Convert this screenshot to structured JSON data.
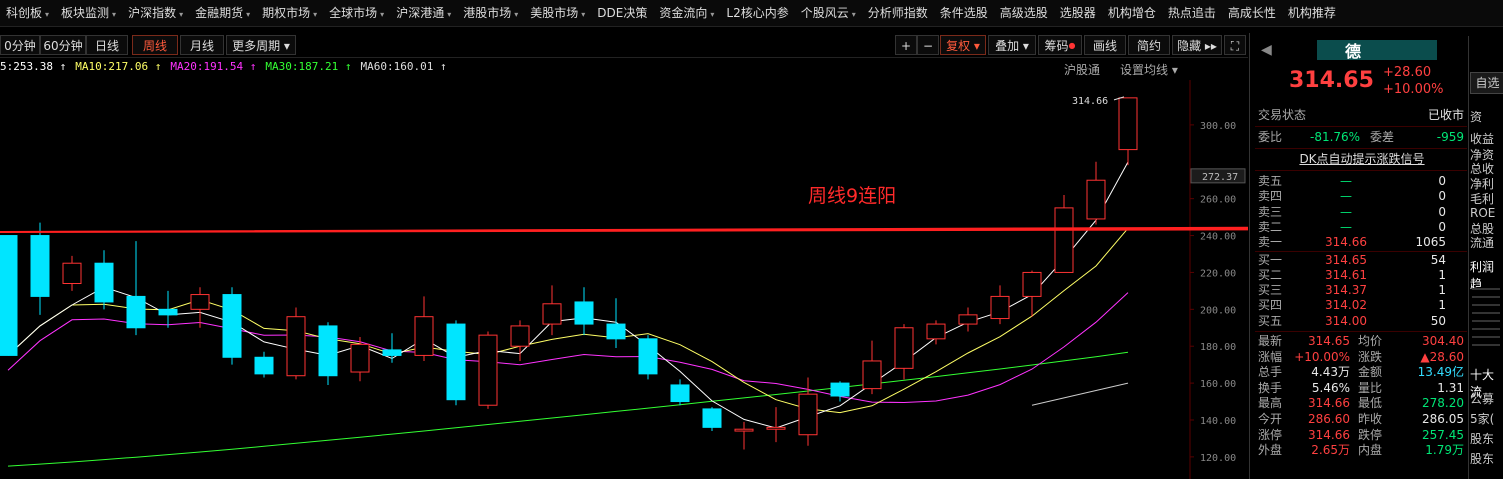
{
  "menu": [
    {
      "label": "科创板",
      "caret": true
    },
    {
      "label": "板块监测",
      "caret": true
    },
    {
      "label": "沪深指数",
      "caret": true
    },
    {
      "label": "金融期货",
      "caret": true
    },
    {
      "label": "期权市场",
      "caret": true
    },
    {
      "label": "全球市场",
      "caret": true
    },
    {
      "label": "沪深港通",
      "caret": true
    },
    {
      "label": "港股市场",
      "caret": true
    },
    {
      "label": "美股市场",
      "caret": true
    },
    {
      "label": "DDE决策",
      "caret": false
    },
    {
      "label": "资金流向",
      "caret": true
    },
    {
      "label": "L2核心内参",
      "caret": false
    },
    {
      "label": "个股风云",
      "caret": true
    },
    {
      "label": "分析师指数",
      "caret": false
    },
    {
      "label": "条件选股",
      "caret": false
    },
    {
      "label": "高级选股",
      "caret": false
    },
    {
      "label": "选股器",
      "caret": false
    },
    {
      "label": "机构增仓",
      "caret": false
    },
    {
      "label": "热点追击",
      "caret": false
    },
    {
      "label": "高成长性",
      "caret": false
    },
    {
      "label": "机构推荐",
      "caret": false
    }
  ],
  "toolbar": {
    "periods": [
      "0分钟",
      "60分钟",
      "日线",
      "周线",
      "月线",
      "更多周期 ▾"
    ],
    "active_period": "周线",
    "right": {
      "plus": "+",
      "minus": "−",
      "fuquan": "复权 ▾",
      "diejia": "叠加 ▾",
      "chouma": "筹码",
      "huaxian": "画线",
      "jianyue": "简约",
      "yincang": "隐藏 ▸▸"
    }
  },
  "ma_row": {
    "ma5": "5:253.38 ↑",
    "ma10": "MA10:217.06 ↑",
    "ma20": "MA20:191.54 ↑",
    "ma30": "MA30:187.21 ↑",
    "ma60": "MA60:160.01 ↑",
    "market": "沪股通",
    "settings": "设置均线 ▾"
  },
  "chart_data": {
    "type": "candlestick",
    "annotation": "周线9连阳",
    "high_label": "314.66",
    "current_price_label": "272.37",
    "yticks": [
      120,
      140,
      160,
      180,
      200,
      220,
      240,
      260,
      300
    ],
    "ytick_labels": [
      "120.00",
      "140.00",
      "160.00",
      "180.00",
      "200.00",
      "220.00",
      "240.00",
      "260.00",
      "300.00"
    ],
    "ylim": [
      108,
      320
    ],
    "candles": [
      {
        "o": 240,
        "c": 175,
        "h": 240,
        "l": 175
      },
      {
        "o": 240,
        "c": 207,
        "h": 247,
        "l": 197
      },
      {
        "o": 214,
        "c": 225,
        "h": 229,
        "l": 210
      },
      {
        "o": 225,
        "c": 204,
        "h": 232,
        "l": 200
      },
      {
        "o": 207,
        "c": 190,
        "h": 237,
        "l": 186
      },
      {
        "o": 200,
        "c": 197,
        "h": 210,
        "l": 190
      },
      {
        "o": 200,
        "c": 208,
        "h": 212,
        "l": 190
      },
      {
        "o": 208,
        "c": 174,
        "h": 212,
        "l": 170
      },
      {
        "o": 174,
        "c": 165,
        "h": 177,
        "l": 163
      },
      {
        "o": 164,
        "c": 196,
        "h": 201,
        "l": 162
      },
      {
        "o": 191,
        "c": 164,
        "h": 193,
        "l": 159
      },
      {
        "o": 166,
        "c": 181,
        "h": 185,
        "l": 161
      },
      {
        "o": 178,
        "c": 175,
        "h": 187,
        "l": 171
      },
      {
        "o": 175,
        "c": 196,
        "h": 207,
        "l": 172
      },
      {
        "o": 192,
        "c": 151,
        "h": 194,
        "l": 148
      },
      {
        "o": 148,
        "c": 186,
        "h": 188,
        "l": 146
      },
      {
        "o": 180,
        "c": 191,
        "h": 194,
        "l": 172
      },
      {
        "o": 192,
        "c": 203,
        "h": 213,
        "l": 186
      },
      {
        "o": 204,
        "c": 192,
        "h": 212,
        "l": 186
      },
      {
        "o": 192,
        "c": 184,
        "h": 206,
        "l": 179
      },
      {
        "o": 184,
        "c": 165,
        "h": 186,
        "l": 162
      },
      {
        "o": 159,
        "c": 150,
        "h": 162,
        "l": 148
      },
      {
        "o": 146,
        "c": 136,
        "h": 147,
        "l": 134
      },
      {
        "o": 134,
        "c": 135,
        "h": 139,
        "l": 124
      },
      {
        "o": 135,
        "c": 136,
        "h": 147,
        "l": 128
      },
      {
        "o": 132,
        "c": 154,
        "h": 163,
        "l": 126
      },
      {
        "o": 160,
        "c": 153,
        "h": 161,
        "l": 150
      },
      {
        "o": 157,
        "c": 172,
        "h": 183,
        "l": 154
      },
      {
        "o": 168,
        "c": 190,
        "h": 192,
        "l": 162
      },
      {
        "o": 184,
        "c": 192,
        "h": 194,
        "l": 181
      },
      {
        "o": 192,
        "c": 197,
        "h": 201,
        "l": 188
      },
      {
        "o": 195,
        "c": 207,
        "h": 213,
        "l": 192
      },
      {
        "o": 207,
        "c": 220,
        "h": 221,
        "l": 196
      },
      {
        "o": 220,
        "c": 255,
        "h": 262,
        "l": 220
      },
      {
        "o": 249,
        "c": 270,
        "h": 280,
        "l": 246
      },
      {
        "o": 286.6,
        "c": 314.66,
        "h": 314.66,
        "l": 278.2
      }
    ],
    "ma_colors": {
      "ma5": "#ffffff",
      "ma10": "#ffff66",
      "ma20": "#ff33ff",
      "ma30": "#33ff33",
      "ma60": "#bbbbbb"
    },
    "up_color": "#ff3333",
    "down_color": "#00e5ff"
  },
  "quote": {
    "name": "德",
    "price": "314.65",
    "change": "+28.60",
    "pct": "+10.00%",
    "trade_state_label": "交易状态",
    "trade_state": "已收市",
    "weibi_label": "委比",
    "weibi": "-81.76%",
    "weicha_label": "委差",
    "weicha": "-959",
    "dk_label": "DK点自动提示涨跌信号",
    "sells": [
      {
        "label": "卖五",
        "price": "—",
        "vol": "0"
      },
      {
        "label": "卖四",
        "price": "—",
        "vol": "0"
      },
      {
        "label": "卖三",
        "price": "—",
        "vol": "0"
      },
      {
        "label": "卖二",
        "price": "—",
        "vol": "0"
      },
      {
        "label": "卖一",
        "price": "314.66",
        "vol": "1065"
      }
    ],
    "buys": [
      {
        "label": "买一",
        "price": "314.65",
        "vol": "54"
      },
      {
        "label": "买二",
        "price": "314.61",
        "vol": "1"
      },
      {
        "label": "买三",
        "price": "314.37",
        "vol": "1"
      },
      {
        "label": "买四",
        "price": "314.02",
        "vol": "1"
      },
      {
        "label": "买五",
        "price": "314.00",
        "vol": "50"
      }
    ],
    "stats": [
      {
        "l1": "最新",
        "v1": "314.65",
        "l2": "均价",
        "v2": "304.40"
      },
      {
        "l1": "涨幅",
        "v1": "+10.00%",
        "l2": "涨跌",
        "v2": "▲28.60"
      },
      {
        "l1": "总手",
        "v1": "4.43万",
        "l2": "金额",
        "v2": "13.49亿"
      },
      {
        "l1": "换手",
        "v1": "5.46%",
        "l2": "量比",
        "v2": "1.31"
      },
      {
        "l1": "最高",
        "v1": "314.66",
        "l2": "最低",
        "v2": "278.20"
      },
      {
        "l1": "今开",
        "v1": "286.60",
        "l2": "昨收",
        "v2": "286.05"
      },
      {
        "l1": "涨停",
        "v1": "314.66",
        "l2": "跌停",
        "v2": "257.45"
      },
      {
        "l1": "外盘",
        "v1": "2.65万",
        "l2": "内盘",
        "v2": "1.79万"
      }
    ]
  },
  "far_right": {
    "zixuan": "自选",
    "items": [
      "资",
      "收益",
      "净资",
      "总收",
      "净利",
      "毛利",
      "ROE",
      "总股",
      "流通",
      "利润趋",
      "十大流",
      "公募",
      "5家(",
      "股东",
      "股东"
    ]
  }
}
